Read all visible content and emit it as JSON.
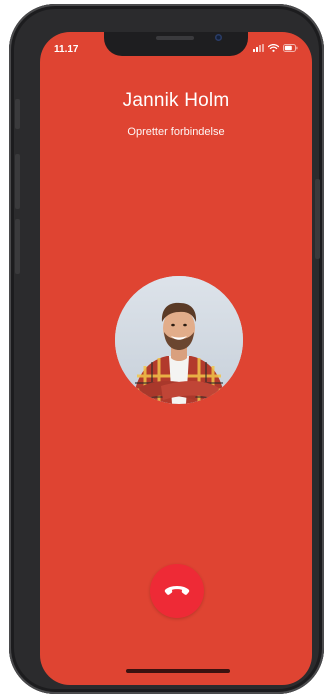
{
  "status_bar": {
    "time": "11.17",
    "icons": [
      "signal-icon",
      "wifi-icon",
      "battery-icon"
    ]
  },
  "call": {
    "caller_name": "Jannik Holm",
    "status": "Opretter forbindelse"
  },
  "colors": {
    "screen_background": "#df4432",
    "end_call_button": "#ee2a36",
    "text": "#ffffff"
  },
  "controls": {
    "end_call_icon": "phone-hangup-icon"
  }
}
